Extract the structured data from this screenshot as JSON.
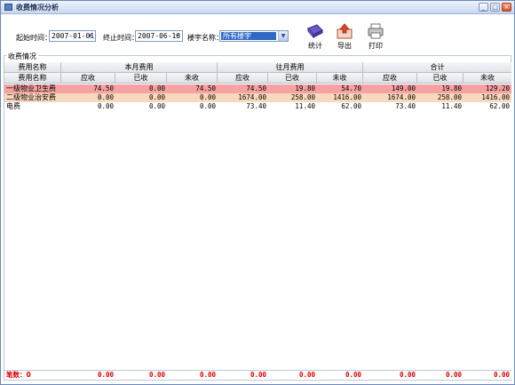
{
  "window": {
    "title": "收费情况分析",
    "buttons": [
      "_",
      "□",
      "×"
    ]
  },
  "filters": {
    "start_label": "起始时间：",
    "start_value": "2007-01-01",
    "end_label": "终止时间：",
    "end_value": "2007-06-13",
    "building_label": "楼宇名称：",
    "building_value": "所有楼宇"
  },
  "toolbar": {
    "stats_label": "统计",
    "export_label": "导出",
    "print_label": "打印"
  },
  "group_label": "收费情况",
  "table": {
    "group_headers": [
      "费用名称",
      "本月费用",
      "往月费用",
      "合计"
    ],
    "sub_headers": [
      "费用名称",
      "应收",
      "已收",
      "未收",
      "应收",
      "已收",
      "未收",
      "应收",
      "已收",
      "未收"
    ],
    "rows": [
      {
        "name": "一级物业卫生费",
        "values": [
          "74.50",
          "0.00",
          "74.50",
          "74.50",
          "19.80",
          "54.70",
          "149.00",
          "19.80",
          "129.20"
        ],
        "highlight": "#f6a2a2"
      },
      {
        "name": "二级物业治安费",
        "values": [
          "0.00",
          "0.00",
          "0.00",
          "1674.00",
          "258.00",
          "1416.00",
          "1674.00",
          "258.00",
          "1416.00"
        ],
        "highlight": "#f8d9bd"
      },
      {
        "name": "电费",
        "values": [
          "0.00",
          "0.00",
          "0.00",
          "73.40",
          "11.40",
          "62.00",
          "73.40",
          "11.40",
          "62.00"
        ],
        "highlight": ""
      }
    ],
    "footer": [
      "笔数：0",
      "0.00",
      "0.00",
      "0.00",
      "0.00",
      "0.00",
      "0.00",
      "0.00",
      "0.00",
      "0.00"
    ]
  },
  "colors": {
    "footer_text": "#e00000",
    "selected": "#316ac5"
  }
}
